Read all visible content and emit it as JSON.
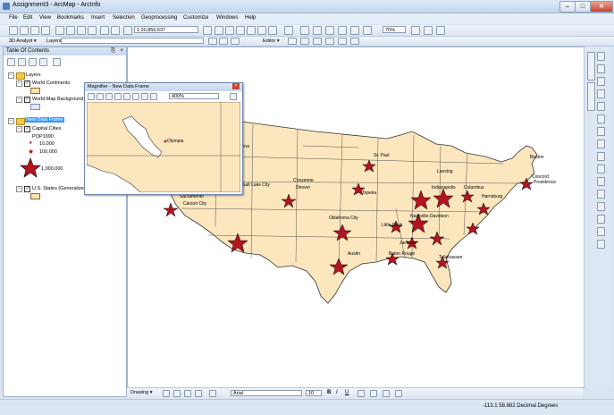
{
  "window": {
    "title": "Assignment3 - ArcMap - ArcInfo"
  },
  "menu": [
    "File",
    "Edit",
    "View",
    "Bookmarks",
    "Insert",
    "Selection",
    "Geoprocessing",
    "Customize",
    "Windows",
    "Help"
  ],
  "toolbar": {
    "scale": "1:20,856,637",
    "analyst_label": "3D Analyst ▾",
    "layers_label": "Layers",
    "editor_label": "Editor ▾",
    "percent": "75%"
  },
  "toc": {
    "title": "Table Of Contents",
    "layers_group": "Layers",
    "layers": [
      "World Continents",
      "World Map Background"
    ],
    "data_frame": "New Data Frame",
    "capital_cities": "Capital Cities",
    "pop_field": "POP1990",
    "legend": [
      "10,000",
      "100,000",
      "1,000,000"
    ],
    "us_states": "U.S. States (Generalized)"
  },
  "magnifier": {
    "title": "Magnifier - New Data Frame",
    "zoom": "400%",
    "city": "Olympia"
  },
  "map": {
    "cities": [
      {
        "name": "Helena"
      },
      {
        "name": "Salt Lake City"
      },
      {
        "name": "Cheyenne"
      },
      {
        "name": "Denver"
      },
      {
        "name": "Sacramento"
      },
      {
        "name": "Carson City"
      },
      {
        "name": "Oklahoma City"
      },
      {
        "name": "Topeka"
      },
      {
        "name": "Austin"
      },
      {
        "name": "Little Rock"
      },
      {
        "name": "Jackson"
      },
      {
        "name": "Baton Rouge"
      },
      {
        "name": "Tallahassee"
      },
      {
        "name": "Nashville-Davidson"
      },
      {
        "name": "Indianapolis"
      },
      {
        "name": "Columbus"
      },
      {
        "name": "Lansing"
      },
      {
        "name": "St. Paul"
      },
      {
        "name": "Harrisburg"
      },
      {
        "name": "Concord"
      },
      {
        "name": "Boston"
      },
      {
        "name": "Providence"
      }
    ]
  },
  "drawing": {
    "label": "Drawing ▾",
    "font": "Arial",
    "size": "10",
    "bold": "B",
    "italic": "I",
    "underline": "U"
  },
  "status": {
    "coords": "-113.1  58.682 Decimal Degrees"
  }
}
